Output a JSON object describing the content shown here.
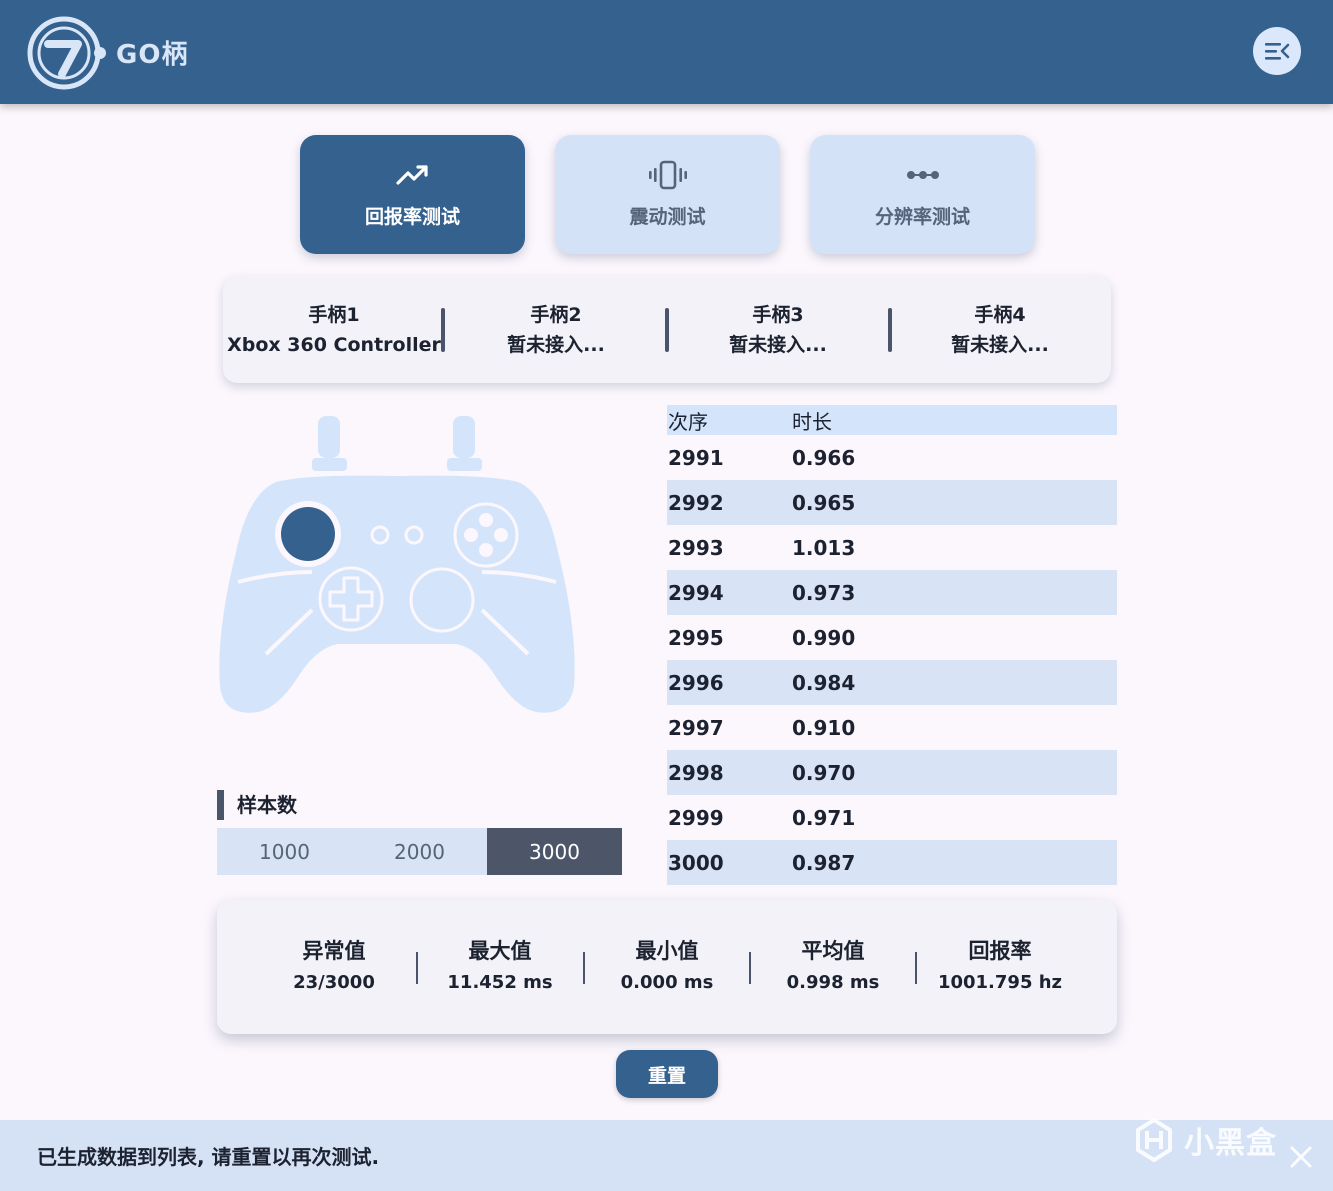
{
  "app": {
    "name": "GO柄"
  },
  "icons": {
    "menu": "menu-collapse-icon",
    "logo": "go-logo-icon",
    "close": "close-icon"
  },
  "colors": {
    "header": "#35618f",
    "accent": "#35618f",
    "light_blue": "#d4e2f7",
    "dark_gray": "#4d5669"
  },
  "modes": [
    {
      "label": "回报率测试",
      "icon": "trending-up-icon",
      "active": true
    },
    {
      "label": "震动测试",
      "icon": "vibration-icon",
      "active": false
    },
    {
      "label": "分辨率测试",
      "icon": "dots-icon",
      "active": false
    }
  ],
  "controllers": [
    {
      "title": "手柄1",
      "status": "Xbox 360 Controller"
    },
    {
      "title": "手柄2",
      "status": "暂未接入..."
    },
    {
      "title": "手柄3",
      "status": "暂未接入..."
    },
    {
      "title": "手柄4",
      "status": "暂未接入..."
    }
  ],
  "sample": {
    "title": "样本数",
    "options": [
      "1000",
      "2000",
      "3000"
    ],
    "selected": "3000"
  },
  "table": {
    "headers": [
      "次序",
      "时长"
    ],
    "rows": [
      [
        "2991",
        "0.966"
      ],
      [
        "2992",
        "0.965"
      ],
      [
        "2993",
        "1.013"
      ],
      [
        "2994",
        "0.973"
      ],
      [
        "2995",
        "0.990"
      ],
      [
        "2996",
        "0.984"
      ],
      [
        "2997",
        "0.910"
      ],
      [
        "2998",
        "0.970"
      ],
      [
        "2999",
        "0.971"
      ],
      [
        "3000",
        "0.987"
      ]
    ]
  },
  "stats": [
    {
      "label": "异常值",
      "value": "23/3000"
    },
    {
      "label": "最大值",
      "value": "11.452 ms"
    },
    {
      "label": "最小值",
      "value": "0.000 ms"
    },
    {
      "label": "平均值",
      "value": "0.998 ms"
    },
    {
      "label": "回报率",
      "value": "1001.795 hz"
    }
  ],
  "reset_label": "重置",
  "status_message": "已生成数据到列表, 请重置以再次测试.",
  "watermark": "小黑盒"
}
